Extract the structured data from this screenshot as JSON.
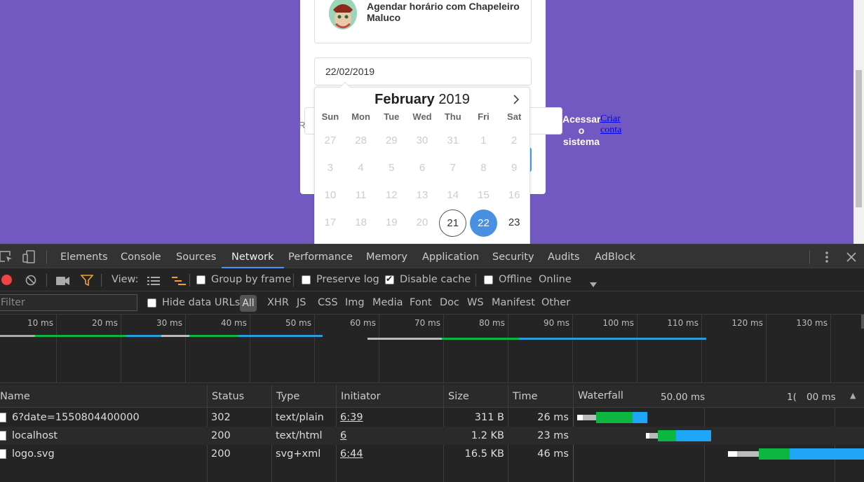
{
  "page": {
    "provider_title": "Agendar horário com Chapeleiro Maluco",
    "date_value": "22/02/2019",
    "stray_r": "R",
    "login_link": "Acessar o sistema",
    "signup_link": "Criar conta",
    "colors": {
      "background": "#7159c1",
      "selected_day": "#4a90e2"
    }
  },
  "datepicker": {
    "month": "February",
    "year": "2019",
    "next_icon": "chevron-right-icon",
    "weekdays": [
      "Sun",
      "Mon",
      "Tue",
      "Wed",
      "Thu",
      "Fri",
      "Sat"
    ],
    "weeks": [
      [
        "27",
        "28",
        "29",
        "30",
        "31",
        "1",
        "2"
      ],
      [
        "3",
        "4",
        "5",
        "6",
        "7",
        "8",
        "9"
      ],
      [
        "10",
        "11",
        "12",
        "13",
        "14",
        "15",
        "16"
      ],
      [
        "17",
        "18",
        "19",
        "20",
        "21",
        "22",
        "23"
      ]
    ],
    "today": "21",
    "selected": "22"
  },
  "devtools": {
    "tabs": [
      "Elements",
      "Console",
      "Sources",
      "Network",
      "Performance",
      "Memory",
      "Application",
      "Security",
      "Audits",
      "AdBlock"
    ],
    "active_tab": "Network",
    "toolbar": {
      "view_label": "View:",
      "group_by_frame": "Group by frame",
      "preserve_log": "Preserve log",
      "disable_cache": "Disable cache",
      "offline": "Offline",
      "throttling": "Online"
    },
    "filterbar": {
      "filter_placeholder": "Filter",
      "hide_data_urls": "Hide data URLs",
      "types": [
        "All",
        "XHR",
        "JS",
        "CSS",
        "Img",
        "Media",
        "Font",
        "Doc",
        "WS",
        "Manifest",
        "Other"
      ]
    },
    "overview_ticks": [
      "10 ms",
      "20 ms",
      "30 ms",
      "40 ms",
      "50 ms",
      "60 ms",
      "70 ms",
      "80 ms",
      "90 ms",
      "100 ms",
      "110 ms",
      "120 ms",
      "130 ms"
    ],
    "table": {
      "columns": [
        "Name",
        "Status",
        "Type",
        "Initiator",
        "Size",
        "Time",
        "Waterfall"
      ],
      "waterfall_labels": [
        "50.00 ms",
        "1(",
        "00 ms"
      ],
      "rows": [
        {
          "name": "6?date=1550804400000",
          "status": "302",
          "type": "text/plain",
          "initiator": "6:39",
          "size": "311 B",
          "time": "26 ms"
        },
        {
          "name": "localhost",
          "status": "200",
          "type": "text/html",
          "initiator": "6",
          "size": "1.2 KB",
          "time": "23 ms"
        },
        {
          "name": "logo.svg",
          "status": "200",
          "type": "svg+xml",
          "initiator": "6:44",
          "size": "16.5 KB",
          "time": "46 ms"
        }
      ]
    }
  }
}
